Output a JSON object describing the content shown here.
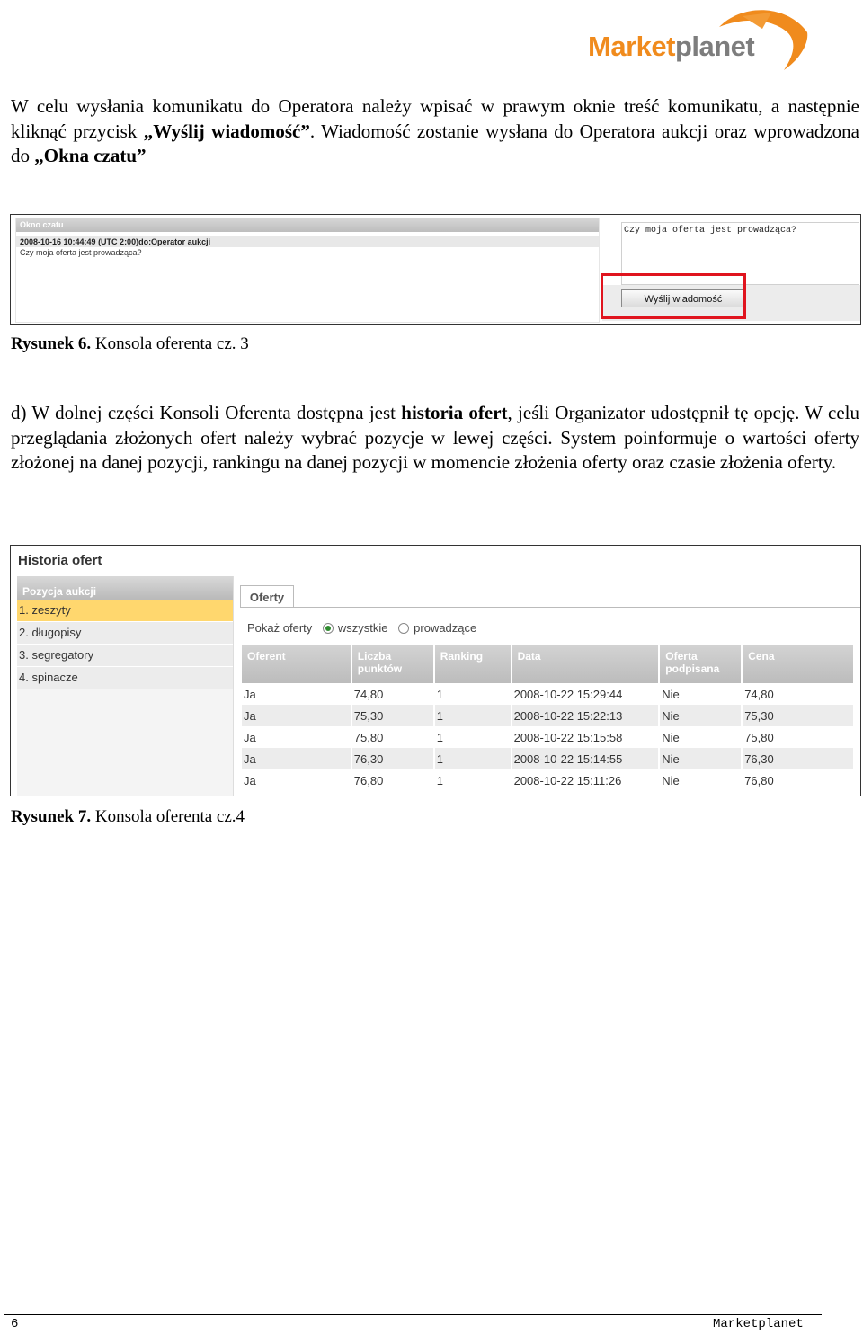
{
  "header": {
    "logo_part1": "Market",
    "logo_part2": "planet"
  },
  "paragraph1": {
    "t1": "W celu wysłania komunikatu do Operatora należy wpisać w prawym oknie treść komunikatu, a następnie kliknąć przycisk ",
    "b1": "„Wyślij wiadomość”",
    "t2": ". Wiadomość zostanie wysłana do Operatora aukcji oraz wprowadzona do ",
    "b2": "„Okna czatu”"
  },
  "figure6": {
    "chat_header": "Okno czatu",
    "chat_line1": "2008-10-16 10:44:49 (UTC 2:00)do:Operator aukcji",
    "chat_line2": "Czy moja oferta jest prowadząca?",
    "message_text": "Czy moja oferta jest prowadząca?",
    "send_button": "Wyślij wiadomość",
    "highlight_color": "#e0141e"
  },
  "caption6": {
    "label": "Rysunek 6.",
    "text": " Konsola oferenta cz. 3"
  },
  "paragraph2": {
    "t1": "d) W dolnej części Konsoli Oferenta dostępna jest ",
    "b1": "historia ofert",
    "t2": ", jeśli Organizator udostępnił tę opcję. W celu przeglądania złożonych ofert należy wybrać pozycje w lewej części. System poinformuje o wartości oferty złożonej na danej pozycji, rankingu na danej pozycji w momencie złożenia oferty oraz czasie złożenia oferty."
  },
  "figure7": {
    "title": "Historia ofert",
    "left_header": "Pozycja aukcji",
    "positions": [
      "1. zeszyty",
      "2. długopisy",
      "3. segregatory",
      "4. spinacze"
    ],
    "tab": "Oferty",
    "filter_label": "Pokaż oferty",
    "filter_all": "wszystkie",
    "filter_leading": "prowadzące",
    "columns": {
      "c1": "Oferent",
      "c2a": "Liczba",
      "c2b": "punktów",
      "c3": "Ranking",
      "c4": "Data",
      "c5a": "Oferta",
      "c5b": "podpisana",
      "c6": "Cena"
    },
    "rows": [
      {
        "oferent": "Ja",
        "punkty": "74,80",
        "ranking": "1",
        "data": "2008-10-22 15:29:44",
        "podpisana": "Nie",
        "cena": "74,80"
      },
      {
        "oferent": "Ja",
        "punkty": "75,30",
        "ranking": "1",
        "data": "2008-10-22 15:22:13",
        "podpisana": "Nie",
        "cena": "75,30"
      },
      {
        "oferent": "Ja",
        "punkty": "75,80",
        "ranking": "1",
        "data": "2008-10-22 15:15:58",
        "podpisana": "Nie",
        "cena": "75,80"
      },
      {
        "oferent": "Ja",
        "punkty": "76,30",
        "ranking": "1",
        "data": "2008-10-22 15:14:55",
        "podpisana": "Nie",
        "cena": "76,30"
      },
      {
        "oferent": "Ja",
        "punkty": "76,80",
        "ranking": "1",
        "data": "2008-10-22 15:11:26",
        "podpisana": "Nie",
        "cena": "76,80"
      }
    ],
    "selected_color": "#ffd76e"
  },
  "caption7": {
    "label": "Rysunek 7.",
    "text": " Konsola oferenta cz.4"
  },
  "footer": {
    "page_number": "6",
    "brand": "Marketplanet"
  }
}
